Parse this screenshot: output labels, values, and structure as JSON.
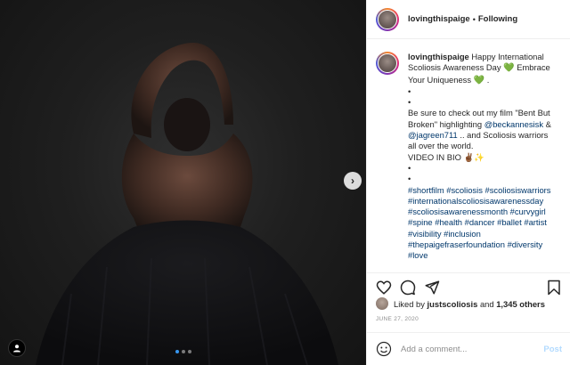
{
  "post": {
    "username": "lovingthispaige",
    "follow_separator": "•",
    "follow_status": "Following"
  },
  "caption": {
    "text1": "Happy International Scoliosis Awareness Day",
    "text2": "Embrace Your Uniqueness",
    "text3": ".",
    "bullet": "•",
    "film_pre": "Be sure to check out my film \"Bent But Broken\" highlighting",
    "mention1": "@beckannesisk",
    "amp": "&",
    "mention2": "@jagreen711",
    "film_post": ".. and Scoliosis warriors all over the world.",
    "video": "VIDEO IN BIO",
    "hashtags": [
      "#shortfilm",
      "#scoliosis",
      "#scoliosiswarriors",
      "#internationalscoliosisawarenessday",
      "#scoliosisawarenessmonth",
      "#curvygirl",
      "#spine",
      "#health",
      "#dancer",
      "#ballet",
      "#artist",
      "#visibility",
      "#inclusion",
      "#thepaigefraserfoundation",
      "#diversity",
      "#love"
    ]
  },
  "likes": {
    "prefix": "Liked by",
    "user": "justscoliosis",
    "and": "and",
    "count": "1,345 others"
  },
  "date": "JUNE 27, 2020",
  "comment": {
    "placeholder": "Add a comment...",
    "post_label": "Post"
  },
  "carousel": {
    "total": 3,
    "active": 0
  },
  "icons": {
    "heart": "green-heart-icon",
    "like": "heart-outline-icon",
    "comment": "comment-icon",
    "share": "share-icon",
    "save": "bookmark-icon",
    "emoji": "emoji-icon",
    "next": "chevron-right-icon",
    "tag": "user-tag-icon"
  },
  "colors": {
    "link": "#00376b",
    "accent_dot": "#3897f0",
    "green_heart": "#31a231"
  }
}
